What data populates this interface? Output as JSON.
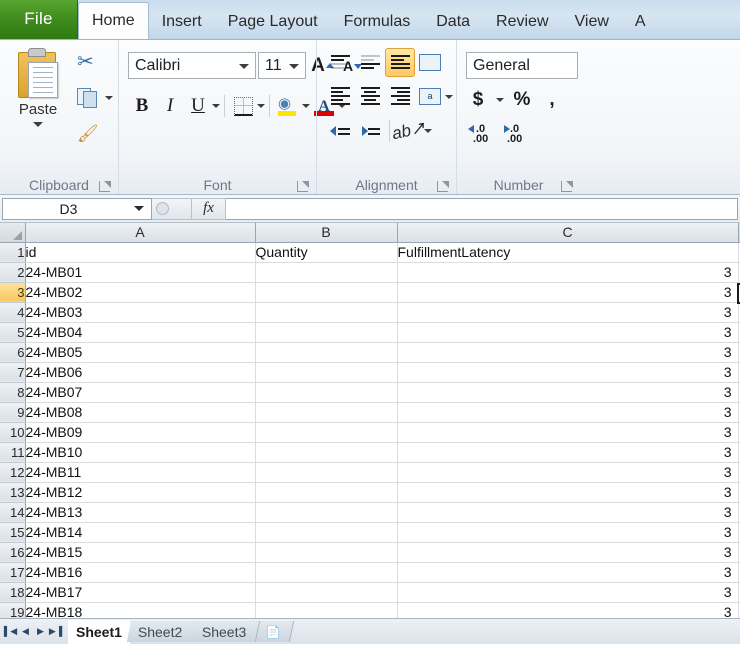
{
  "ribbon_tabs": [
    {
      "label": "File",
      "active": false,
      "kind": "file"
    },
    {
      "label": "Home",
      "active": true,
      "kind": "normal"
    },
    {
      "label": "Insert",
      "active": false,
      "kind": "normal"
    },
    {
      "label": "Page Layout",
      "active": false,
      "kind": "normal"
    },
    {
      "label": "Formulas",
      "active": false,
      "kind": "normal"
    },
    {
      "label": "Data",
      "active": false,
      "kind": "normal"
    },
    {
      "label": "Review",
      "active": false,
      "kind": "normal"
    },
    {
      "label": "View",
      "active": false,
      "kind": "normal"
    },
    {
      "label": "A",
      "active": false,
      "kind": "clipped"
    }
  ],
  "groups": {
    "clipboard": {
      "label": "Clipboard",
      "paste_label": "Paste",
      "cut_icon": "scissors-icon",
      "copy_icon": "copy-icon",
      "format_painter_icon": "paintbrush-icon",
      "paste_icon": "clipboard-icon"
    },
    "font": {
      "label": "Font",
      "font_name": "Calibri",
      "font_size": "11",
      "bold_label": "B",
      "italic_label": "I",
      "underline_label": "U",
      "grow_font_label": "A",
      "shrink_font_label": "A",
      "border_icon": "borders-icon",
      "fill_color_icon": "fill-color-icon",
      "font_color_icon": "font-color-icon",
      "fill_color": "#ffe400",
      "font_color": "#e00000"
    },
    "alignment": {
      "label": "Alignment",
      "top_align_icon": "align-top-icon",
      "middle_align_icon": "align-middle-icon",
      "bottom_align_icon": "align-bottom-icon",
      "orientation_icon": "orientation-icon",
      "align_left_icon": "align-left-icon",
      "align_center_icon": "align-center-icon",
      "align_right_icon": "align-right-icon",
      "wrap_text_icon": "wrap-text-icon",
      "merge_center_icon": "merge-center-icon",
      "merge_center_label": "a",
      "decrease_indent_icon": "decrease-indent-icon",
      "increase_indent_icon": "increase-indent-icon",
      "selected_button": "bottom-align"
    },
    "number": {
      "label": "Number",
      "format_value": "General",
      "currency_label": "$",
      "percent_label": "%",
      "comma_label": ",",
      "increase_decimal_label": ".00",
      "decrease_decimal_label": ".00",
      "increase_decimal_icon": "increase-decimal-icon",
      "decrease_decimal_icon": "decrease-decimal-icon"
    }
  },
  "formula_bar": {
    "name_box_value": "D3",
    "fx_label": "fx",
    "formula_value": ""
  },
  "sheet": {
    "columns": [
      {
        "letter": "A",
        "selected": false
      },
      {
        "letter": "B",
        "selected": false
      },
      {
        "letter": "C",
        "selected": false
      }
    ],
    "active_cell": "D3",
    "selected_row": 3,
    "rows": [
      {
        "num": "1",
        "A": "id",
        "B": "Quantity",
        "C": "FulfillmentLatency",
        "c_numeric": false
      },
      {
        "num": "2",
        "A": "24-MB01",
        "B": "",
        "C": "3",
        "c_numeric": true
      },
      {
        "num": "3",
        "A": "24-MB02",
        "B": "",
        "C": "3",
        "c_numeric": true
      },
      {
        "num": "4",
        "A": "24-MB03",
        "B": "",
        "C": "3",
        "c_numeric": true
      },
      {
        "num": "5",
        "A": "24-MB04",
        "B": "",
        "C": "3",
        "c_numeric": true
      },
      {
        "num": "6",
        "A": "24-MB05",
        "B": "",
        "C": "3",
        "c_numeric": true
      },
      {
        "num": "7",
        "A": "24-MB06",
        "B": "",
        "C": "3",
        "c_numeric": true
      },
      {
        "num": "8",
        "A": "24-MB07",
        "B": "",
        "C": "3",
        "c_numeric": true
      },
      {
        "num": "9",
        "A": "24-MB08",
        "B": "",
        "C": "3",
        "c_numeric": true
      },
      {
        "num": "10",
        "A": "24-MB09",
        "B": "",
        "C": "3",
        "c_numeric": true
      },
      {
        "num": "11",
        "A": "24-MB10",
        "B": "",
        "C": "3",
        "c_numeric": true
      },
      {
        "num": "12",
        "A": "24-MB11",
        "B": "",
        "C": "3",
        "c_numeric": true
      },
      {
        "num": "13",
        "A": "24-MB12",
        "B": "",
        "C": "3",
        "c_numeric": true
      },
      {
        "num": "14",
        "A": "24-MB13",
        "B": "",
        "C": "3",
        "c_numeric": true
      },
      {
        "num": "15",
        "A": "24-MB14",
        "B": "",
        "C": "3",
        "c_numeric": true
      },
      {
        "num": "16",
        "A": "24-MB15",
        "B": "",
        "C": "3",
        "c_numeric": true
      },
      {
        "num": "17",
        "A": "24-MB16",
        "B": "",
        "C": "3",
        "c_numeric": true
      },
      {
        "num": "18",
        "A": "24-MB17",
        "B": "",
        "C": "3",
        "c_numeric": true
      },
      {
        "num": "19",
        "A": "24-MB18",
        "B": "",
        "C": "3",
        "c_numeric": true
      }
    ]
  },
  "sheet_tabs": {
    "nav_first": "▌◀",
    "nav_prev": "◀",
    "nav_next": "▶",
    "nav_last": "▶▐",
    "tabs": [
      {
        "label": "Sheet1",
        "active": true
      },
      {
        "label": "Sheet2",
        "active": false
      },
      {
        "label": "Sheet3",
        "active": false
      }
    ],
    "insert_sheet_icon": "insert-worksheet-icon"
  }
}
